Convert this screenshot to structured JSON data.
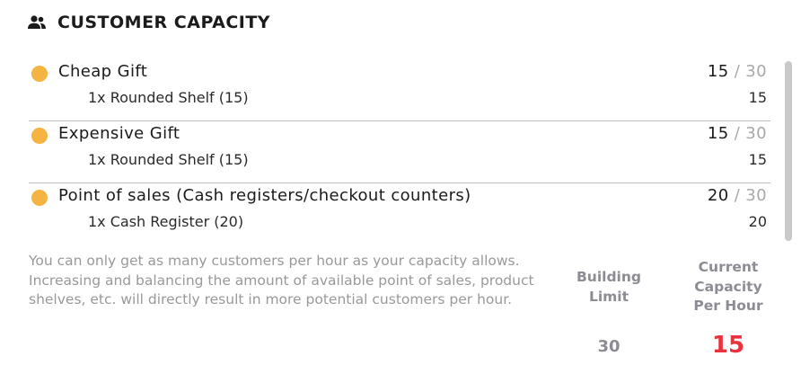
{
  "header": {
    "title": "CUSTOMER CAPACITY",
    "icon": "users-icon"
  },
  "items": [
    {
      "name": "Cheap Gift",
      "current": "15",
      "separator": "/",
      "max": "30",
      "sub_name": "1x Rounded Shelf (15)",
      "sub_value": "15",
      "status_color": "#f5b342"
    },
    {
      "name": "Expensive Gift",
      "current": "15",
      "separator": "/",
      "max": "30",
      "sub_name": "1x Rounded Shelf (15)",
      "sub_value": "15",
      "status_color": "#f5b342"
    },
    {
      "name": "Point of sales (Cash registers/checkout counters)",
      "current": "20",
      "separator": "/",
      "max": "30",
      "sub_name": "1x Cash Register (20)",
      "sub_value": "20",
      "status_color": "#f5b342"
    }
  ],
  "note": "You can only get as many customers per hour as your capacity allows. Increasing and balancing the amount of available point of sales, product shelves, etc. will directly result in more potential customers per hour.",
  "stats": {
    "building_limit": {
      "label_line1": "Building",
      "label_line2": "Limit",
      "value": "30"
    },
    "current_capacity": {
      "label_line1": "Current",
      "label_line2": "Capacity",
      "label_line3": "Per Hour",
      "value": "15",
      "value_color": "#e8333f"
    }
  }
}
